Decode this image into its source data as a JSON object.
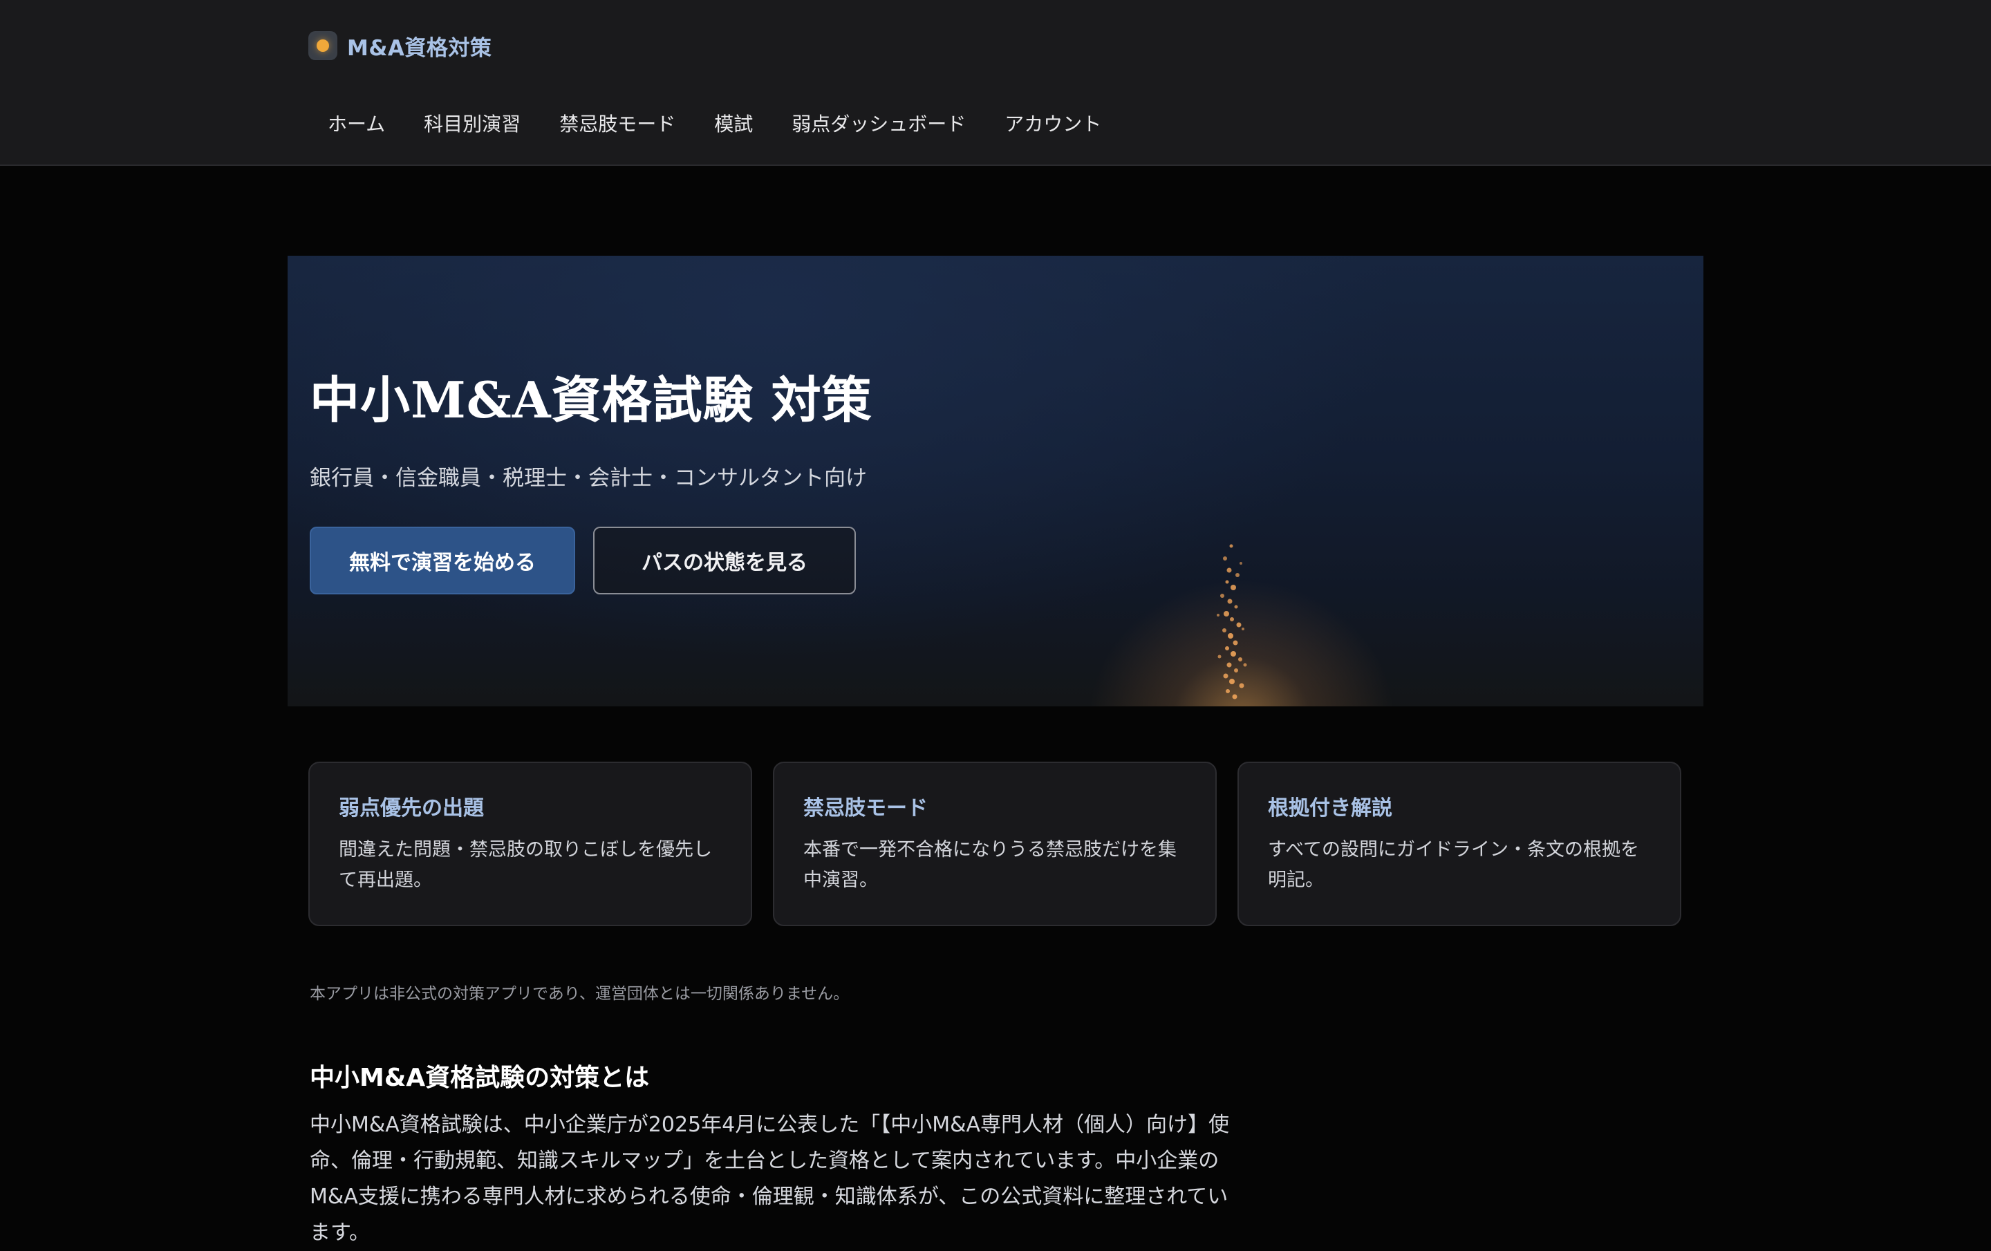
{
  "header": {
    "brand_title": "M&A資格対策",
    "brand_icon": "amber-dot-icon",
    "nav": [
      {
        "label": "ホーム"
      },
      {
        "label": "科目別演習"
      },
      {
        "label": "禁忌肢モード"
      },
      {
        "label": "模試"
      },
      {
        "label": "弱点ダッシュボード"
      },
      {
        "label": "アカウント"
      }
    ]
  },
  "hero": {
    "title": "中小M&A資格試験 対策",
    "subtitle": "銀行員・信金職員・税理士・会計士・コンサルタント向け",
    "primary_button": "無料で演習を始める",
    "secondary_button": "パスの状態を見る"
  },
  "features": [
    {
      "title": "弱点優先の出題",
      "text": "間違えた問題・禁忌肢の取りこぼしを優先して再出題。"
    },
    {
      "title": "禁忌肢モード",
      "text": "本番で一発不合格になりうる禁忌肢だけを集中演習。"
    },
    {
      "title": "根拠付き解説",
      "text": "すべての設問にガイドライン・条文の根拠を明記。"
    }
  ],
  "disclaimer": "本アプリは非公式の対策アプリであり、運営団体とは一切関係ありません。",
  "about": {
    "heading": "中小M&A資格試験の対策とは",
    "body": "中小M&A資格試験は、中小企業庁が2025年4月に公表した「【中小M&A専門人材（個人）向け】使命、倫理・行動規範、知識スキルマップ」を土台とした資格として案内されています。中小企業のM&A支援に携わる専門人材に求められる使命・倫理観・知識体系が、この公式資料に整理されています。"
  },
  "colors": {
    "accent_blue": "#a9c2e6",
    "primary_button": "#2d5388",
    "brand_dot": "#f0a83a",
    "background": "#050505"
  }
}
